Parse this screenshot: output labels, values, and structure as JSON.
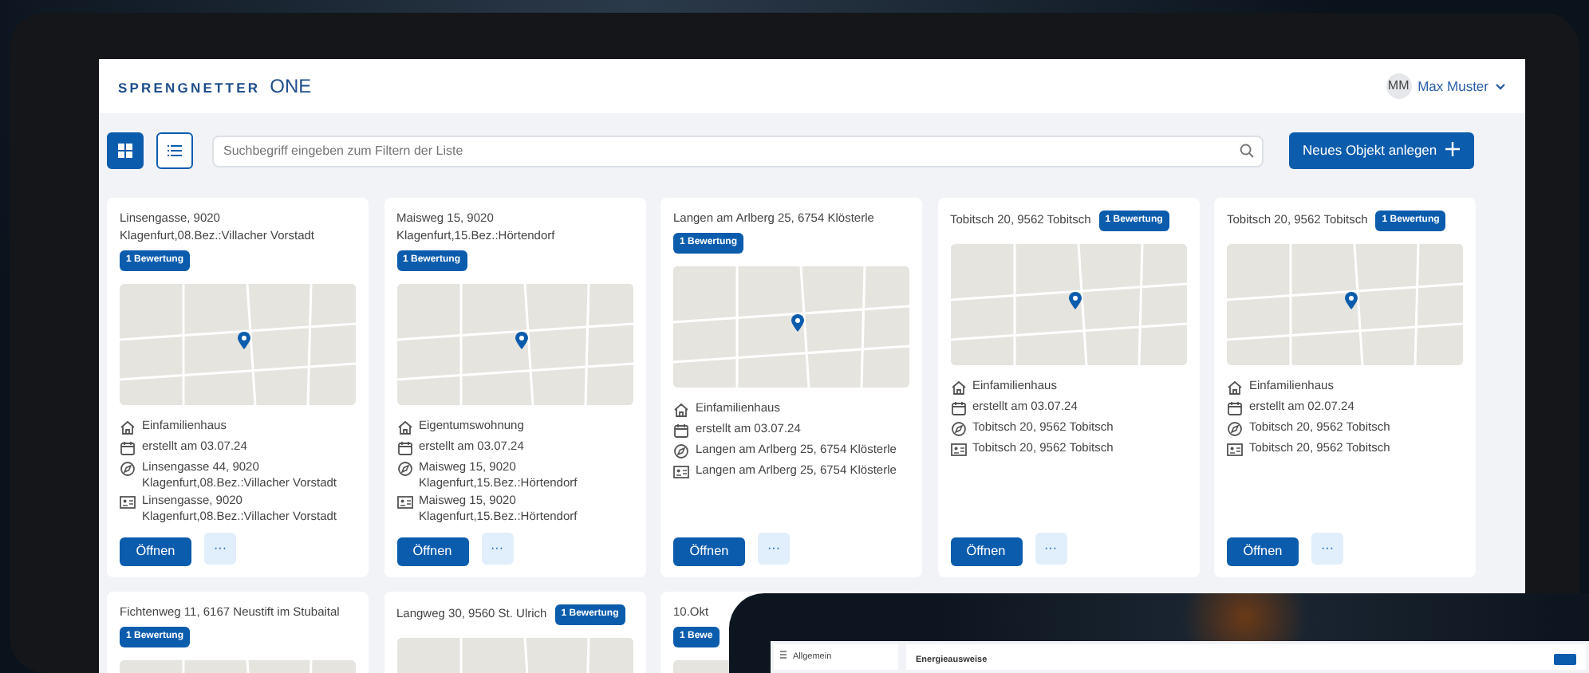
{
  "header": {
    "logo": "SPRENGNETTER",
    "logo_suffix": "ONE",
    "user": {
      "initials": "MM",
      "name": "Max Muster"
    }
  },
  "toolbar": {
    "views": [
      {
        "kind": "grid",
        "selected": true
      },
      {
        "kind": "list",
        "selected": false
      }
    ],
    "search": {
      "placeholder": "Suchbegriff eingeben zum Filtern der Liste"
    },
    "new_button": "Neues Objekt anlegen"
  },
  "cards": [
    {
      "title": "Linsengasse, 9020\nKlagenfurt,08.Bez.:Villacher Vorstadt",
      "badge": "1 Bewertung",
      "details": [
        {
          "kind": "type",
          "text": "Einfamilienhaus"
        },
        {
          "kind": "created",
          "text": "erstellt am 03.07.24"
        },
        {
          "kind": "location",
          "text": "Linsengasse 44, 9020\nKlagenfurt,08.Bez.:Villacher Vorstadt"
        },
        {
          "kind": "address",
          "text": "Linsengasse, 9020\nKlagenfurt,08.Bez.:Villacher Vorstadt"
        }
      ],
      "open_button": "Öffnen",
      "more_button": "···"
    },
    {
      "title": "Maisweg 15, 9020\nKlagenfurt,15.Bez.:Hörtendorf",
      "badge": "1 Bewertung",
      "details": [
        {
          "kind": "type",
          "text": "Eigentumswohnung"
        },
        {
          "kind": "created",
          "text": "erstellt am 03.07.24"
        },
        {
          "kind": "location",
          "text": "Maisweg 15, 9020\nKlagenfurt,15.Bez.:Hörtendorf"
        },
        {
          "kind": "address",
          "text": "Maisweg 15, 9020\nKlagenfurt,15.Bez.:Hörtendorf"
        }
      ],
      "open_button": "Öffnen",
      "more_button": "···"
    },
    {
      "title": "Langen am Arlberg 25, 6754 Klösterle",
      "badge": "1 Bewertung",
      "details": [
        {
          "kind": "type",
          "text": "Einfamilienhaus"
        },
        {
          "kind": "created",
          "text": "erstellt am 03.07.24"
        },
        {
          "kind": "location",
          "text": "Langen am Arlberg 25, 6754 Klösterle"
        },
        {
          "kind": "address",
          "text": "Langen am Arlberg 25, 6754 Klösterle"
        }
      ],
      "open_button": "Öffnen",
      "more_button": "···"
    },
    {
      "title": "Tobitsch 20, 9562 Tobitsch",
      "badge": "1 Bewertung",
      "details": [
        {
          "kind": "type",
          "text": "Einfamilienhaus"
        },
        {
          "kind": "created",
          "text": "erstellt am 03.07.24"
        },
        {
          "kind": "location",
          "text": "Tobitsch 20, 9562 Tobitsch"
        },
        {
          "kind": "address",
          "text": "Tobitsch 20, 9562 Tobitsch"
        }
      ],
      "open_button": "Öffnen",
      "more_button": "···"
    },
    {
      "title": "Tobitsch 20, 9562 Tobitsch",
      "badge": "1 Bewertung",
      "details": [
        {
          "kind": "type",
          "text": "Einfamilienhaus"
        },
        {
          "kind": "created",
          "text": "erstellt am 02.07.24"
        },
        {
          "kind": "location",
          "text": "Tobitsch 20, 9562 Tobitsch"
        },
        {
          "kind": "address",
          "text": "Tobitsch 20, 9562 Tobitsch"
        }
      ],
      "open_button": "Öffnen",
      "more_button": "···"
    },
    {
      "title": "Fichtenweg 11, 6167 Neustift im Stubaital",
      "badge": "1 Bewertung"
    },
    {
      "title": "Langweg 30, 9560 St. Ulrich",
      "badge": "1 Bewertung"
    },
    {
      "title": "10.Okt",
      "badge": "1 Bewe"
    }
  ],
  "second_device": {
    "sidebar_item": "Allgemein",
    "panel_title": "Energieausweise"
  }
}
